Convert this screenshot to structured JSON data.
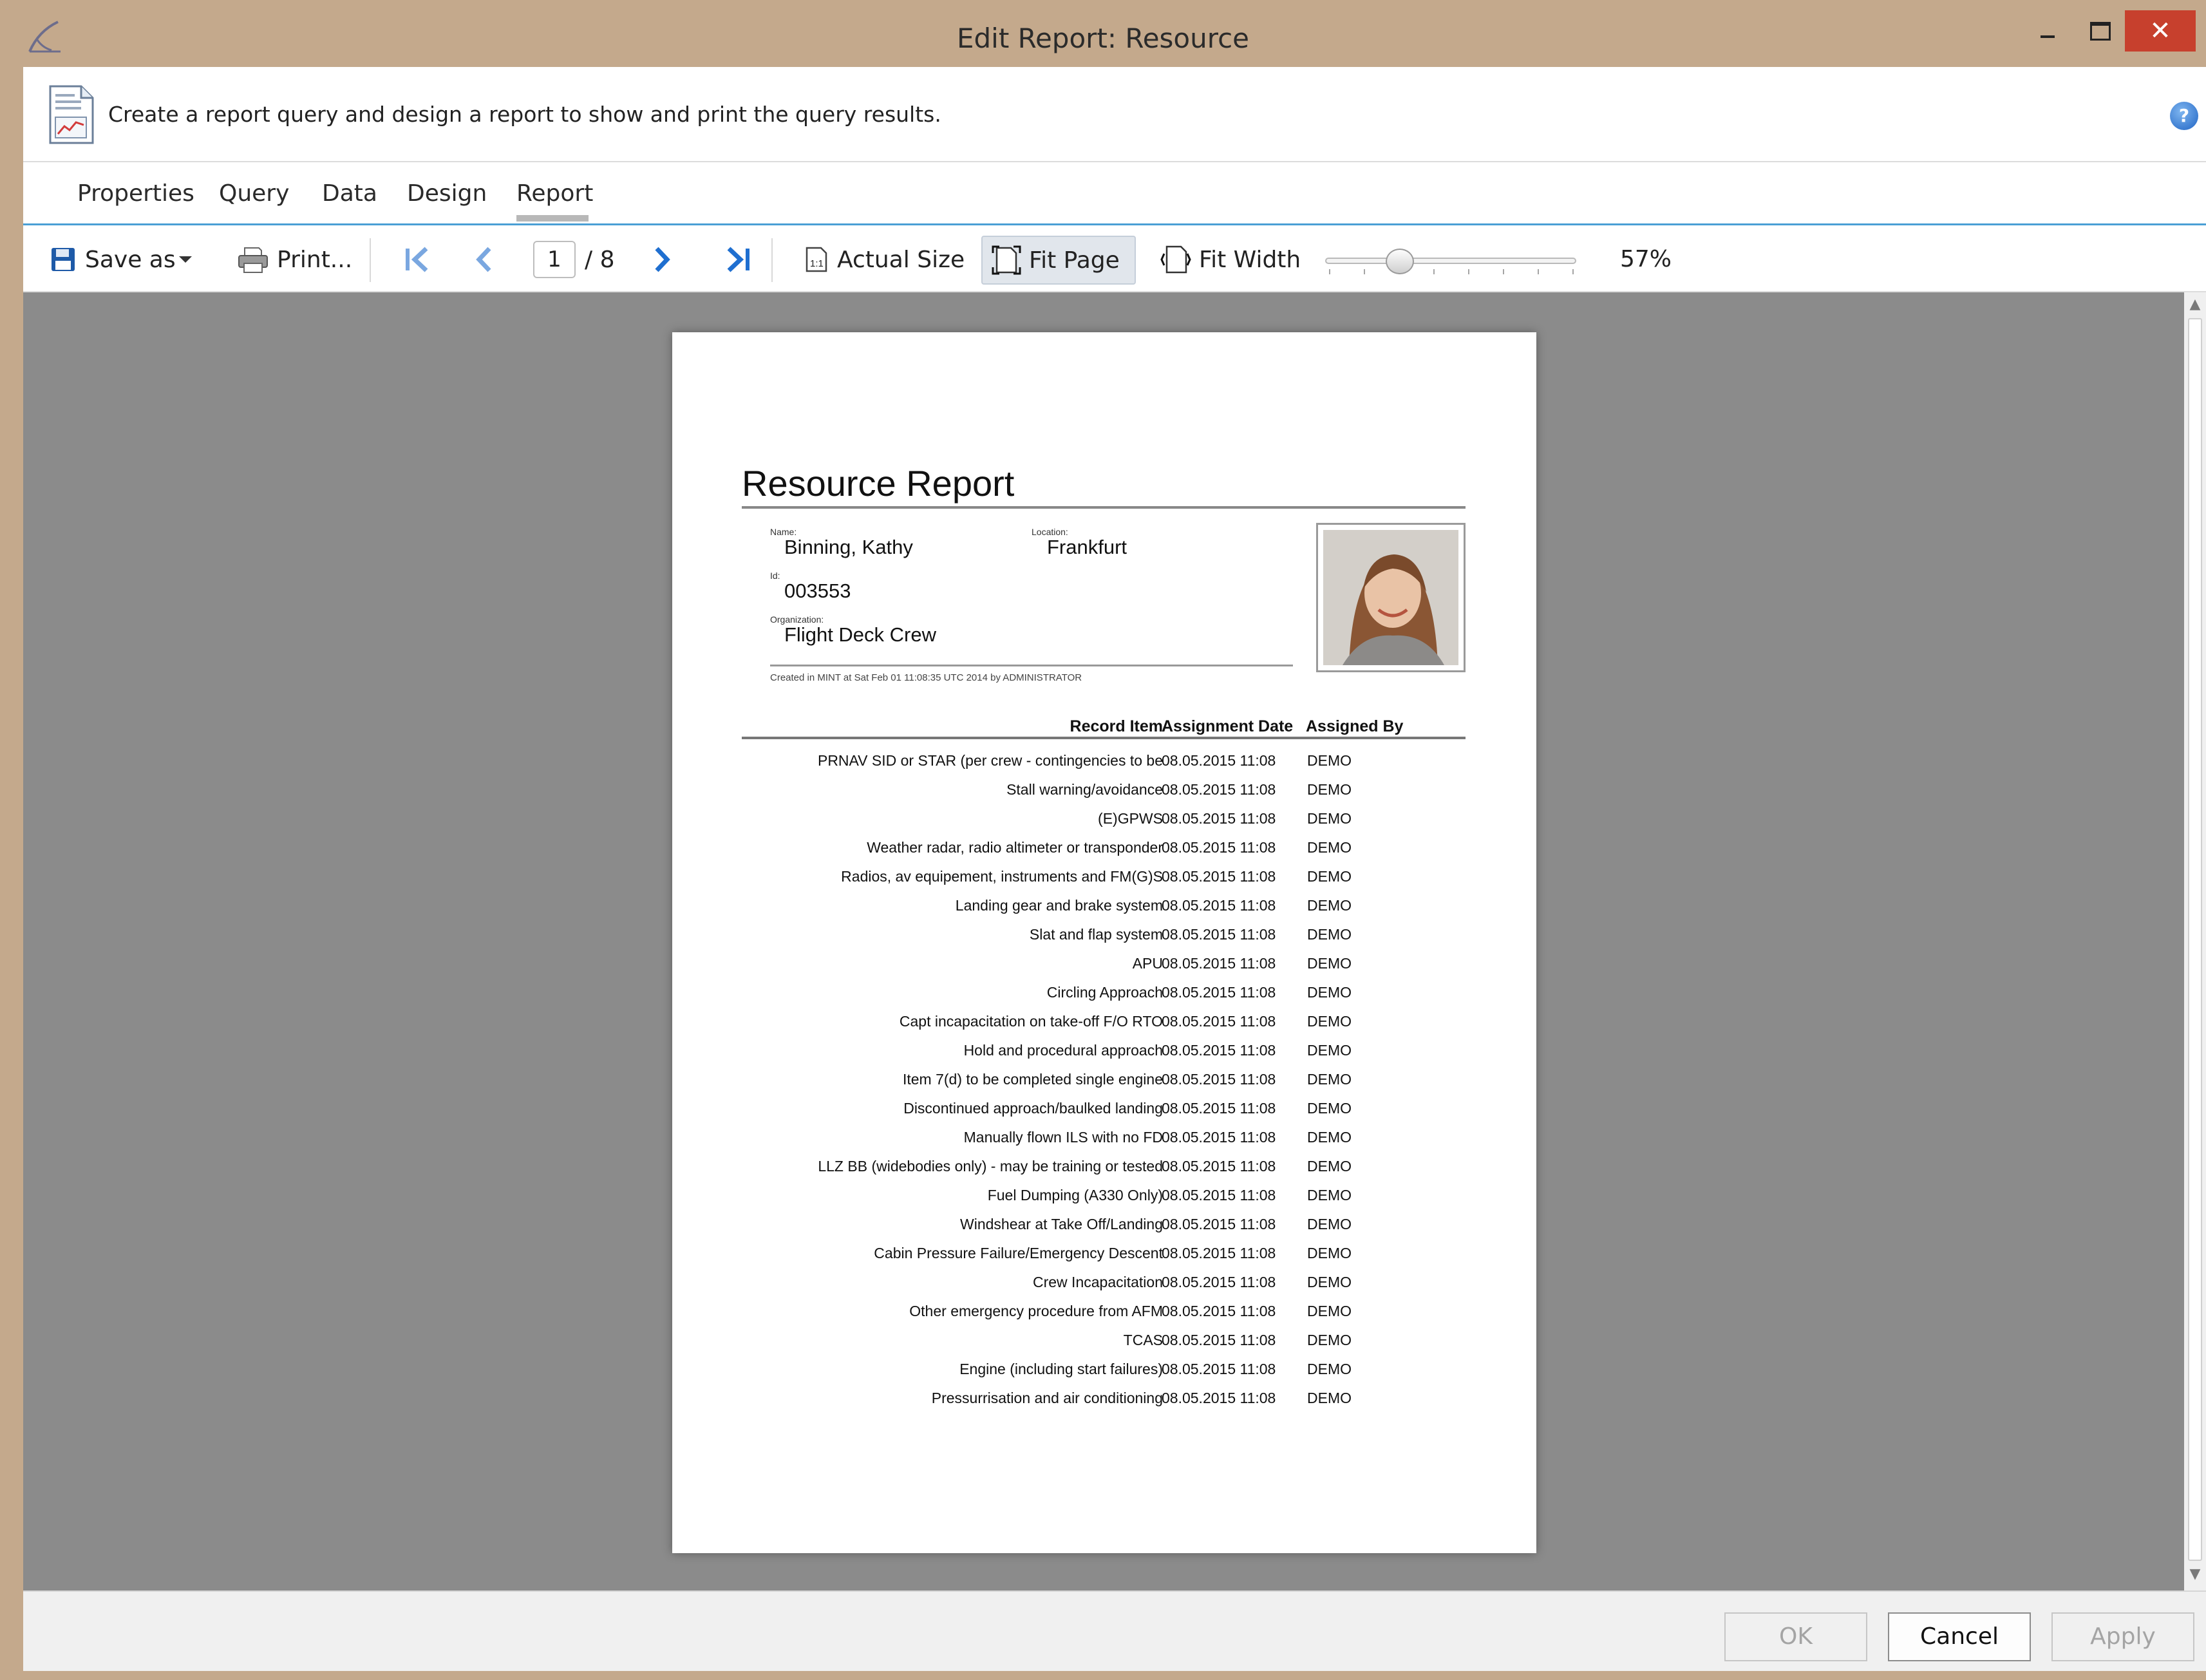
{
  "window": {
    "title": "Edit Report: Resource"
  },
  "description": "Create a report query and design a report to show and print the query results.",
  "tabs": [
    {
      "label": "Properties"
    },
    {
      "label": "Query"
    },
    {
      "label": "Data"
    },
    {
      "label": "Design"
    },
    {
      "label": "Report",
      "active": true
    }
  ],
  "toolbar": {
    "save_as_label": "Save as",
    "print_label": "Print...",
    "current_page": "1",
    "page_total": "/ 8",
    "actual_size_label": "Actual Size",
    "fit_page_label": "Fit Page",
    "fit_width_label": "Fit Width",
    "zoom_value": "57%",
    "zoom_level": 0.57
  },
  "report": {
    "title": "Resource Report",
    "name_label": "Name:",
    "name": "Binning, Kathy",
    "location_label": "Location:",
    "location": "Frankfurt",
    "id_label": "Id:",
    "id": "003553",
    "organization_label": "Organization:",
    "organization": "Flight Deck Crew",
    "created_note": "Created in MINT at Sat Feb 01 11:08:35 UTC 2014 by ADMINISTRATOR",
    "columns": [
      "Record Item",
      "Assignment Date",
      "Assigned By"
    ],
    "rows": [
      {
        "item": "PRNAV SID or STAR (per crew - contingencies to be",
        "date": "08.05.2015 11:08",
        "by": "DEMO"
      },
      {
        "item": "Stall warning/avoidance",
        "date": "08.05.2015 11:08",
        "by": "DEMO"
      },
      {
        "item": "(E)GPWS",
        "date": "08.05.2015 11:08",
        "by": "DEMO"
      },
      {
        "item": "Weather radar, radio altimeter or transponder",
        "date": "08.05.2015 11:08",
        "by": "DEMO"
      },
      {
        "item": "Radios, av equipement, instruments and FM(G)S",
        "date": "08.05.2015 11:08",
        "by": "DEMO"
      },
      {
        "item": "Landing gear and brake system",
        "date": "08.05.2015 11:08",
        "by": "DEMO"
      },
      {
        "item": "Slat and flap system",
        "date": "08.05.2015 11:08",
        "by": "DEMO"
      },
      {
        "item": "APU",
        "date": "08.05.2015 11:08",
        "by": "DEMO"
      },
      {
        "item": "Circling Approach",
        "date": "08.05.2015 11:08",
        "by": "DEMO"
      },
      {
        "item": "Capt incapacitation on take-off F/O RTO",
        "date": "08.05.2015 11:08",
        "by": "DEMO"
      },
      {
        "item": "Hold and procedural approach",
        "date": "08.05.2015 11:08",
        "by": "DEMO"
      },
      {
        "item": "Item 7(d) to be completed single engine",
        "date": "08.05.2015 11:08",
        "by": "DEMO"
      },
      {
        "item": "Discontinued approach/baulked landing",
        "date": "08.05.2015 11:08",
        "by": "DEMO"
      },
      {
        "item": "Manually flown ILS with no FD",
        "date": "08.05.2015 11:08",
        "by": "DEMO"
      },
      {
        "item": "LLZ BB (widebodies only) - may be training or tested",
        "date": "08.05.2015 11:08",
        "by": "DEMO"
      },
      {
        "item": "Fuel Dumping (A330 Only)",
        "date": "08.05.2015 11:08",
        "by": "DEMO"
      },
      {
        "item": "Windshear at Take Off/Landing",
        "date": "08.05.2015 11:08",
        "by": "DEMO"
      },
      {
        "item": "Cabin Pressure Failure/Emergency Descent",
        "date": "08.05.2015 11:08",
        "by": "DEMO"
      },
      {
        "item": "Crew Incapacitation",
        "date": "08.05.2015 11:08",
        "by": "DEMO"
      },
      {
        "item": "Other emergency procedure from AFM",
        "date": "08.05.2015 11:08",
        "by": "DEMO"
      },
      {
        "item": "TCAS",
        "date": "08.05.2015 11:08",
        "by": "DEMO"
      },
      {
        "item": "Engine (including start failures)",
        "date": "08.05.2015 11:08",
        "by": "DEMO"
      },
      {
        "item": "Pressurrisation and air conditioning",
        "date": "08.05.2015 11:08",
        "by": "DEMO"
      }
    ]
  },
  "footer": {
    "ok_label": "OK",
    "cancel_label": "Cancel",
    "apply_label": "Apply"
  },
  "colors": {
    "title_bar": "#c4a98c",
    "close_button": "#c7402d",
    "tab_accent": "#4a9fd5",
    "preview_bg": "#8b8b8b",
    "nav_arrow": "#1f6fd0"
  },
  "icons": {
    "app": "mint-logo-icon",
    "document": "chart-document-icon",
    "help": "help-icon",
    "save": "floppy-disk-icon",
    "print": "printer-icon",
    "first": "first-page-icon",
    "prev": "chevron-left-icon",
    "next": "chevron-right-icon",
    "last": "last-page-icon",
    "actual_size": "actual-size-icon",
    "fit_page": "fit-page-icon",
    "fit_width": "fit-width-icon"
  }
}
